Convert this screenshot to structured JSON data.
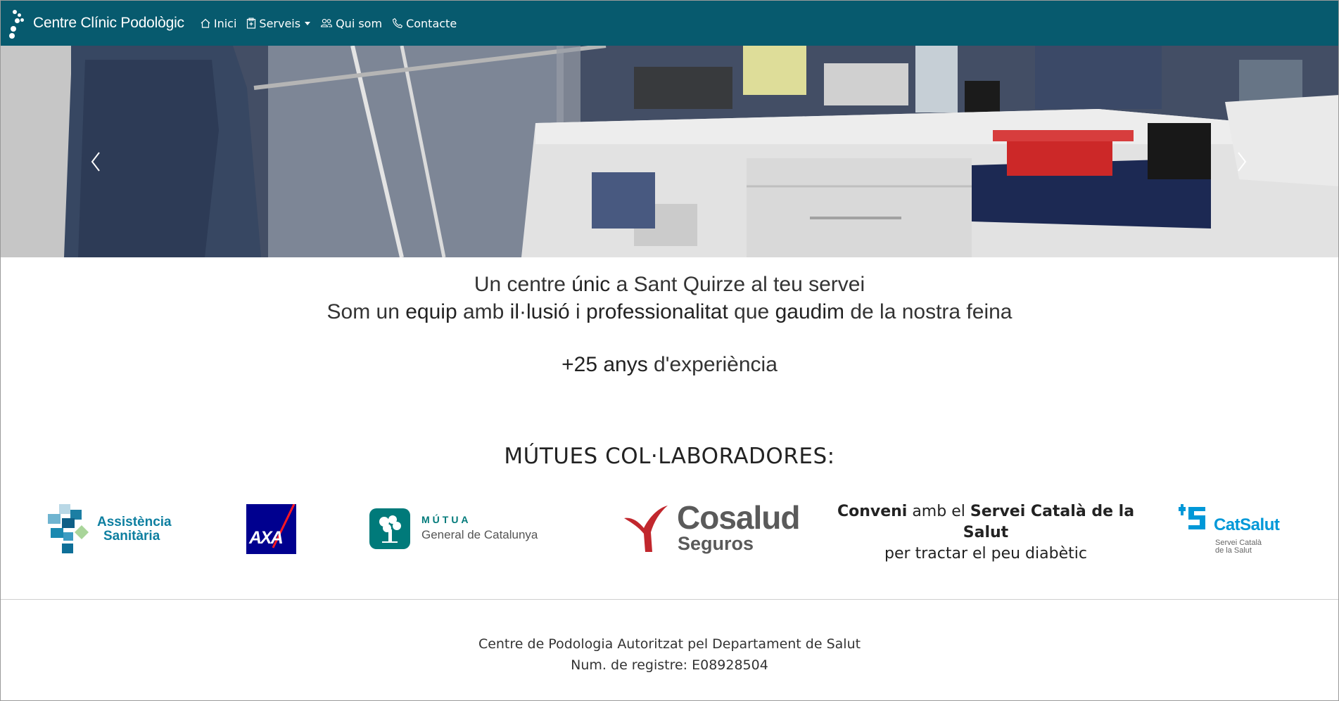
{
  "nav": {
    "brand": "Centre Clínic Podològic",
    "items": [
      {
        "label": "Inici",
        "icon": "home-icon"
      },
      {
        "label": "Serveis",
        "icon": "clipboard-icon",
        "dropdown": true
      },
      {
        "label": "Qui som",
        "icon": "people-icon"
      },
      {
        "label": "Contacte",
        "icon": "phone-icon"
      }
    ]
  },
  "carousel": {
    "prev_icon": "chevron-left-icon",
    "next_icon": "chevron-right-icon"
  },
  "intro": {
    "l1_a": "Un centre ",
    "l1_b": "únic",
    "l1_c": " a Sant Quirze al teu servei",
    "l2_a": "Som un ",
    "l2_b": "equip",
    "l2_c": " amb ",
    "l2_d": "il·lusió",
    "l2_e": " i ",
    "l2_f": "professionalitat",
    "l2_g": " que ",
    "l2_h": "gaudim",
    "l2_i": " de la nostra feina",
    "l3_a": "+25 anys",
    "l3_b": " d'experiència"
  },
  "mutues": {
    "title": "MÚTUES COL·LABORADORES:",
    "assistencia_l1": "Assistència",
    "assistencia_l2": "Sanitària",
    "axa": "AXA",
    "mutua_l1": "MÚTUA",
    "mutua_l2": "General de Catalunya",
    "cosalud_l1": "Cosalud",
    "cosalud_l2": "Seguros",
    "conveni_a": "Conveni",
    "conveni_b": " amb el ",
    "conveni_c": "Servei Català de la Salut",
    "conveni_d": "per tractar el peu diabètic",
    "catsalut": "CatSalut",
    "catsalut_sub1": "Servei Català",
    "catsalut_sub2": "de la Salut"
  },
  "footer": {
    "line1": "Centre de Podologia Autoritzat pel Departament de Salut",
    "line2": "Num. de registre: E08928504"
  },
  "colors": {
    "navbar": "#075a6e",
    "assistencia": "#0e7fa0",
    "axa": "#00008f",
    "mutua": "#007a7a",
    "cosalud": "#c1272d",
    "catsalut": "#0098d8"
  }
}
